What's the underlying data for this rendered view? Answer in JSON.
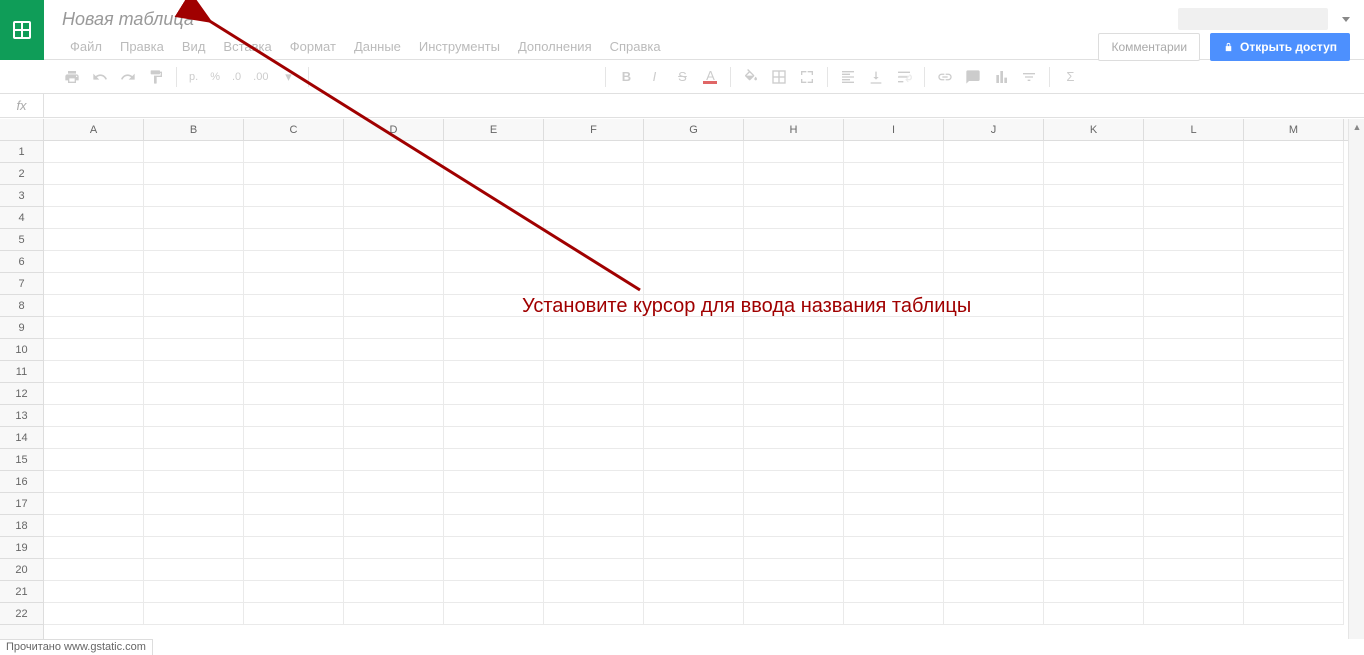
{
  "header": {
    "doc_title": "Новая таблица",
    "menus": [
      "Файл",
      "Правка",
      "Вид",
      "Вставка",
      "Формат",
      "Данные",
      "Инструменты",
      "Дополнения",
      "Справка"
    ],
    "comments_btn": "Комментарии",
    "share_btn": "Открыть доступ"
  },
  "toolbar": {
    "currency": "p.",
    "percent": "%",
    "decimal_dec": ".0",
    "decimal_inc": ".00"
  },
  "fx": {
    "label": "fx"
  },
  "grid": {
    "columns": [
      "A",
      "B",
      "C",
      "D",
      "E",
      "F",
      "G",
      "H",
      "I",
      "J",
      "K",
      "L",
      "M"
    ],
    "rows": [
      "1",
      "2",
      "3",
      "4",
      "5",
      "6",
      "7",
      "8",
      "9",
      "10",
      "11",
      "12",
      "13",
      "14",
      "15",
      "16",
      "17",
      "18",
      "19",
      "20",
      "21",
      "22"
    ]
  },
  "annotation": {
    "text": "Установите курсор для ввода названия таблицы"
  },
  "status": "Прочитано www.gstatic.com"
}
